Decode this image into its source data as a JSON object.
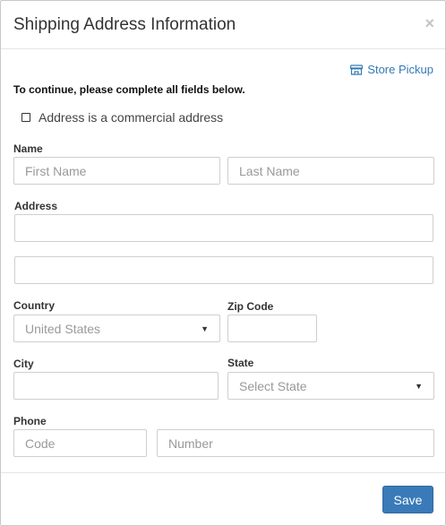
{
  "dialog": {
    "title": "Shipping Address Information",
    "close_glyph": "×"
  },
  "store_pickup": {
    "label": "Store Pickup",
    "icon": "storefront-icon"
  },
  "instructions": "To continue, please complete all fields below.",
  "commercial_checkbox": {
    "label": "Address is a commercial address",
    "checked": false
  },
  "name": {
    "label": "Name",
    "first_placeholder": "First Name",
    "last_placeholder": "Last Name"
  },
  "address": {
    "label": "Address",
    "line1_value": "",
    "line2_value": ""
  },
  "country": {
    "label": "Country",
    "selected": "United States"
  },
  "zip": {
    "label": "Zip Code",
    "value": ""
  },
  "city": {
    "label": "City",
    "value": ""
  },
  "state": {
    "label": "State",
    "selected": "Select State"
  },
  "phone": {
    "label": "Phone",
    "code_placeholder": "Code",
    "number_placeholder": "Number"
  },
  "footer": {
    "save_label": "Save"
  },
  "colors": {
    "primary": "#3a7ab8",
    "link": "#337ab7"
  }
}
